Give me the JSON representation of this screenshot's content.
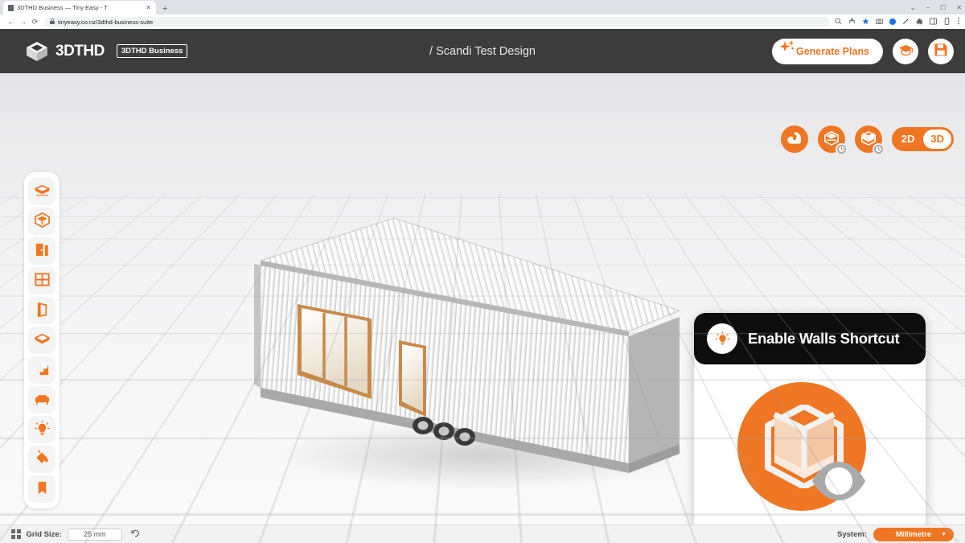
{
  "browser": {
    "tab": {
      "title": "3DTHD Business — Tiny Easy - T",
      "favicon": "site-favicon",
      "close": "✕"
    },
    "new_tab": "+",
    "nav": {
      "back": "←",
      "forward": "→",
      "reload": "⟳"
    },
    "url": "tinyeasy.co.nz/3dthd-business-suite",
    "lock": "🔒",
    "toolbar_icons": [
      "zoom-icon",
      "share-icon",
      "bookmark-star-icon",
      "screenshot-icon",
      "profile-icon",
      "edit-icon",
      "extensions-icon",
      "sidepanel-icon",
      "password-icon",
      "menu-icon"
    ],
    "window_controls": [
      "⌄",
      "−",
      "☐",
      "✕"
    ]
  },
  "appbar": {
    "brand_name": "3DTHD",
    "brand_badge": "3DTHD Business",
    "doc_title": "/ Scandi Test Design",
    "generate_label": "Generate Plans",
    "buttons": [
      {
        "name": "graduation-cap-button",
        "icon": "graduation-cap-icon"
      },
      {
        "name": "save-button",
        "icon": "floppy-disk-icon"
      }
    ]
  },
  "view_controls": {
    "buttons": [
      {
        "name": "measure-tool-button",
        "icon": "tape-measure-icon",
        "badge": false
      },
      {
        "name": "toggle-roof-button",
        "icon": "roof-icon",
        "badge": true
      },
      {
        "name": "toggle-walls-button",
        "icon": "walls-icon",
        "badge": true
      }
    ],
    "dimension_toggle": {
      "options": [
        "2D",
        "3D"
      ],
      "active": "3D"
    }
  },
  "toolbar": {
    "items": [
      {
        "name": "tool-floor",
        "icon": "floor-slab-icon"
      },
      {
        "name": "tool-room",
        "icon": "room-box-icon"
      },
      {
        "name": "tool-door",
        "icon": "door-icon"
      },
      {
        "name": "tool-window",
        "icon": "window-icon"
      },
      {
        "name": "tool-wall",
        "icon": "wall-panel-icon"
      },
      {
        "name": "tool-layer",
        "icon": "layer-slab-icon"
      },
      {
        "name": "tool-stairs",
        "icon": "stairs-icon"
      },
      {
        "name": "tool-furniture",
        "icon": "sofa-icon"
      },
      {
        "name": "tool-lighting",
        "icon": "light-bulb-icon"
      },
      {
        "name": "tool-paint",
        "icon": "paint-bucket-icon"
      },
      {
        "name": "tool-bookmark",
        "icon": "bookmark-icon"
      }
    ]
  },
  "tip_card": {
    "title": "Enable Walls Shortcut",
    "header_icon": "light-bulb-icon",
    "art": {
      "main_icon": "walls-room-icon",
      "overlay_icon": "eye-icon"
    }
  },
  "bottom_bar": {
    "grid_icon": "grid-icon",
    "grid_label": "Grid Size:",
    "grid_value": "25 mm",
    "grid_placeholder": "25 mm",
    "reset_icon": "reset-arrow-icon",
    "system_label": "System:",
    "system_value": "Millimetre",
    "system_caret": "▼"
  },
  "viewport": {
    "model_name": "tiny-house-on-wheels",
    "description": "Corrugated metal clad tiny house with timber framed windows on a three axle trailer"
  },
  "colors": {
    "accent": "#ef7622",
    "appbar": "#3c3c3c",
    "tip_header": "#0d0d0d",
    "canvas": "#f2f2f3",
    "toolbar_tile": "#f4f4f4"
  }
}
